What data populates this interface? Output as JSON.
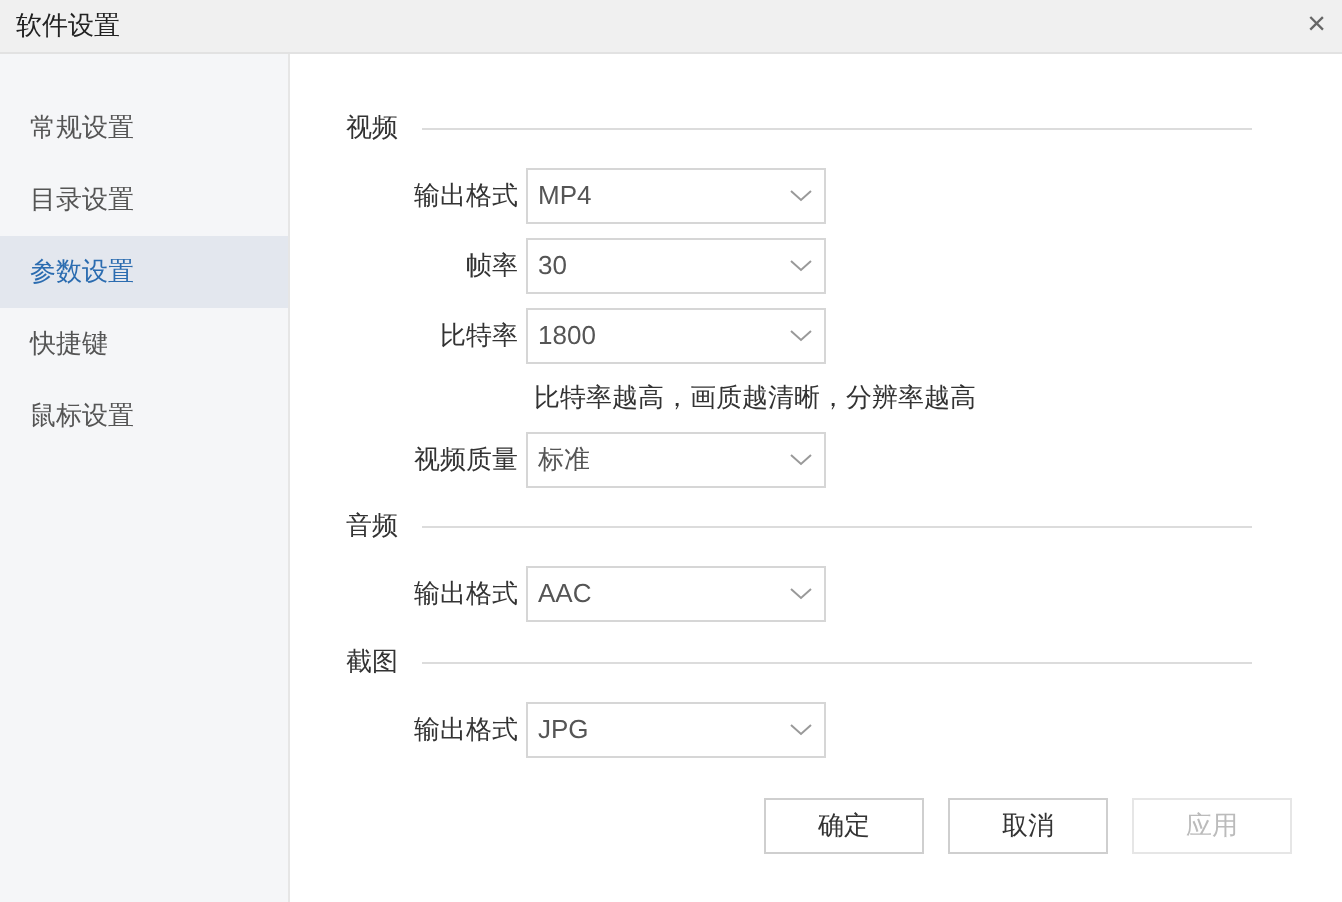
{
  "window": {
    "title": "软件设置",
    "close": "×"
  },
  "sidebar": {
    "items": [
      {
        "label": "常规设置",
        "selected": false
      },
      {
        "label": "目录设置",
        "selected": false
      },
      {
        "label": "参数设置",
        "selected": true
      },
      {
        "label": "快捷键",
        "selected": false
      },
      {
        "label": "鼠标设置",
        "selected": false
      }
    ]
  },
  "sections": [
    {
      "title": "视频",
      "rows": [
        {
          "kind": "select",
          "label": "输出格式",
          "value": "MP4"
        },
        {
          "kind": "select",
          "label": "帧率",
          "value": "30"
        },
        {
          "kind": "select",
          "label": "比特率",
          "value": "1800"
        },
        {
          "kind": "hint",
          "text": "比特率越高，画质越清晰，分辨率越高"
        },
        {
          "kind": "select",
          "label": "视频质量",
          "value": "标准"
        }
      ]
    },
    {
      "title": "音频",
      "rows": [
        {
          "kind": "select",
          "label": "输出格式",
          "value": "AAC"
        }
      ]
    },
    {
      "title": "截图",
      "rows": [
        {
          "kind": "select",
          "label": "输出格式",
          "value": "JPG"
        }
      ]
    }
  ],
  "buttons": [
    {
      "label": "确定",
      "disabled": false
    },
    {
      "label": "取消",
      "disabled": false
    },
    {
      "label": "应用",
      "disabled": true
    }
  ]
}
